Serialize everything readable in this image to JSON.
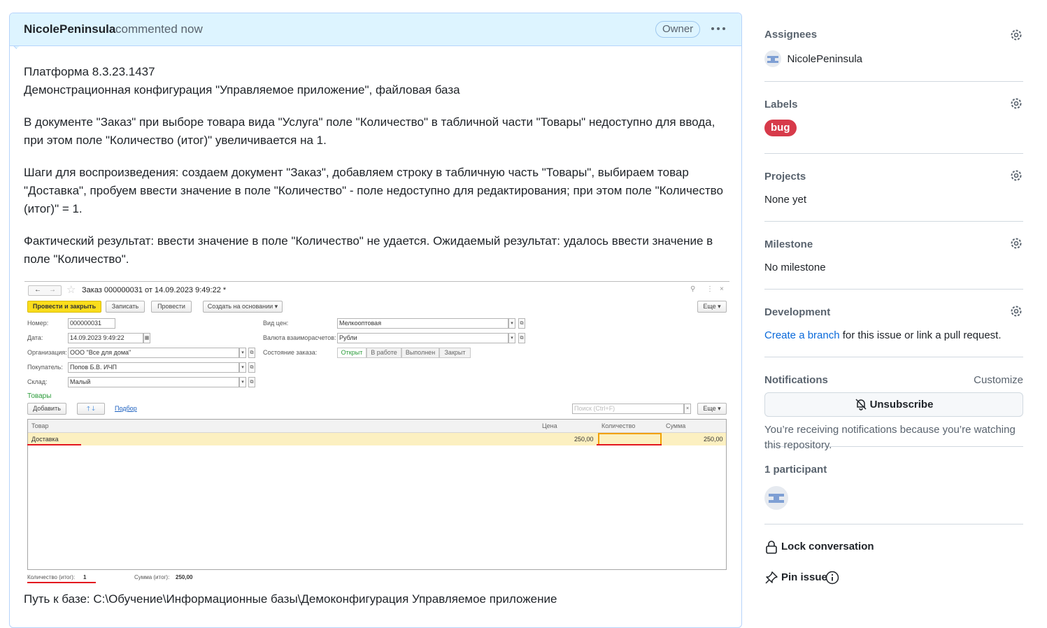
{
  "comment": {
    "author": "NicolePeninsula",
    "action": "commented now",
    "role_badge": "Owner",
    "paragraphs": {
      "p1_line1": "Платформа 8.3.23.1437",
      "p1_line2": "Демонстрационная конфигурация \"Управляемое приложение\", файловая база",
      "p2": "В документе \"Заказ\" при выборе товара вида \"Услуга\" поле \"Количество\" в табличной части \"Товары\" недоступно для ввода, при этом поле \"Количество (итог)\" увеличивается на 1.",
      "p3": "Шаги для воспроизведения: создаем документ \"Заказ\", добавляем строку в табличную часть \"Товары\", выбираем товар \"Доставка\", пробуем ввести значение в поле \"Количество\" - поле недоступно для редактирования; при этом поле \"Количество (итог)\" = 1.",
      "p4": "Фактический результат: ввести значение в поле \"Количество\" не удается. Ожидаемый результат: удалось ввести значение в поле \"Количество\"."
    },
    "footer": "Путь к базе: C:\\Обучение\\Информационные базы\\Демоконфигурация Управляемое приложение"
  },
  "screenshot": {
    "title": "Заказ 000000031 от 14.09.2023 9:49:22 *",
    "buttons": {
      "post_close": "Провести и закрыть",
      "save": "Записать",
      "post": "Провести",
      "create_based": "Создать на основании",
      "more": "Еще"
    },
    "fields": {
      "number_label": "Номер:",
      "number_value": "000000031",
      "date_label": "Дата:",
      "date_value": "14.09.2023  9:49:22",
      "org_label": "Организация:",
      "org_value": "ООО \"Все для дома\"",
      "buyer_label": "Покупатель:",
      "buyer_value": "Попов Б.В. ИЧП",
      "warehouse_label": "Склад:",
      "warehouse_value": "Малый",
      "price_type_label": "Вид цен:",
      "price_type_value": "Мелкооптовая",
      "currency_label": "Валюта взаиморасчетов:",
      "currency_value": "Рубли",
      "status_label": "Состояние заказа:"
    },
    "status_options": [
      "Открыт",
      "В работе",
      "Выполнен",
      "Закрыт"
    ],
    "goods_section": "Товары",
    "goods_toolbar": {
      "add": "Добавить",
      "pick": "Подбор",
      "search_placeholder": "Поиск (Ctrl+F)",
      "more": "Еще"
    },
    "table": {
      "columns": [
        "Товар",
        "Цена",
        "Количество",
        "Сумма"
      ],
      "row": {
        "item": "Доставка",
        "price": "250,00",
        "qty": "",
        "sum": "250,00"
      }
    },
    "totals": {
      "qty_label": "Количество (итог):",
      "qty_value": "1",
      "sum_label": "Сумма (итог):",
      "sum_value": "250,00"
    }
  },
  "sidebar": {
    "assignees": {
      "title": "Assignees",
      "user": "NicolePeninsula"
    },
    "labels": {
      "title": "Labels",
      "label": "bug",
      "label_color": "#d73a4a"
    },
    "projects": {
      "title": "Projects",
      "value": "None yet"
    },
    "milestone": {
      "title": "Milestone",
      "value": "No milestone"
    },
    "development": {
      "title": "Development",
      "link_text": "Create a branch",
      "rest_text": " for this issue or link a pull request."
    },
    "notifications": {
      "title": "Notifications",
      "customize": "Customize",
      "button": "Unsubscribe",
      "description": "You’re receiving notifications because you’re watching this repository."
    },
    "participants": {
      "title": "1 participant"
    },
    "lock": "Lock conversation",
    "pin": "Pin issue"
  }
}
